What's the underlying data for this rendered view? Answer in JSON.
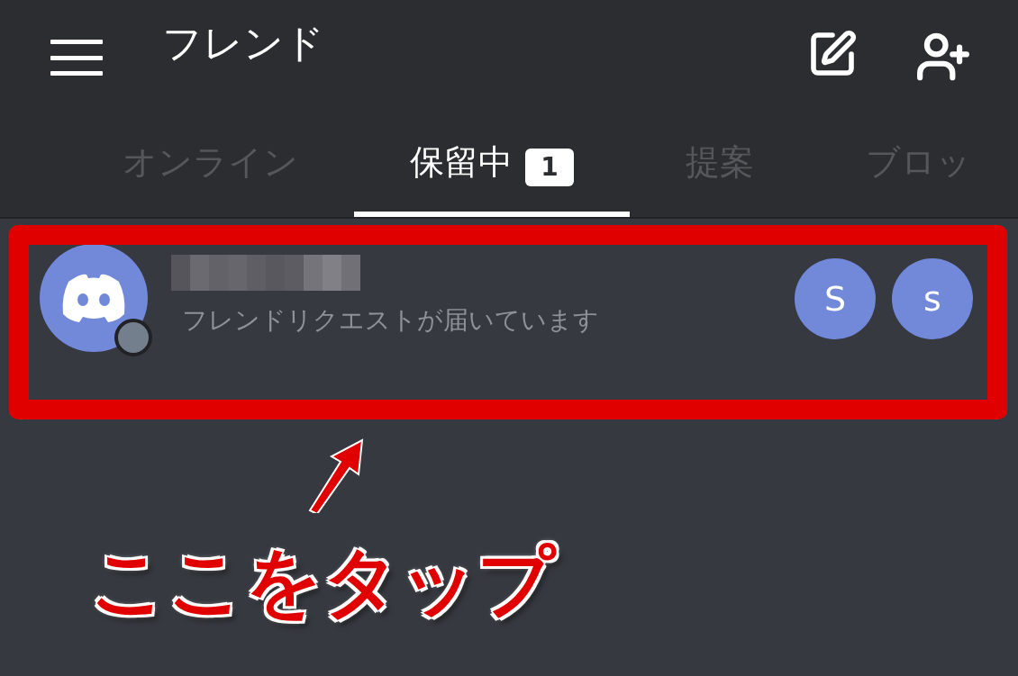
{
  "header": {
    "title": "フレンド"
  },
  "tabs": [
    {
      "label": "オンライン",
      "selected": false
    },
    {
      "label": "保留中",
      "selected": true,
      "badge": "1"
    },
    {
      "label": "提案",
      "selected": false
    },
    {
      "label": "ブロッ",
      "selected": false
    }
  ],
  "requests": [
    {
      "color": "#747f8d",
      "subtitle": "フレンドリクエストが届いています",
      "actions": [
        "S",
        "s"
      ]
    }
  ],
  "annotation": {
    "text": "ここをタップ"
  }
}
